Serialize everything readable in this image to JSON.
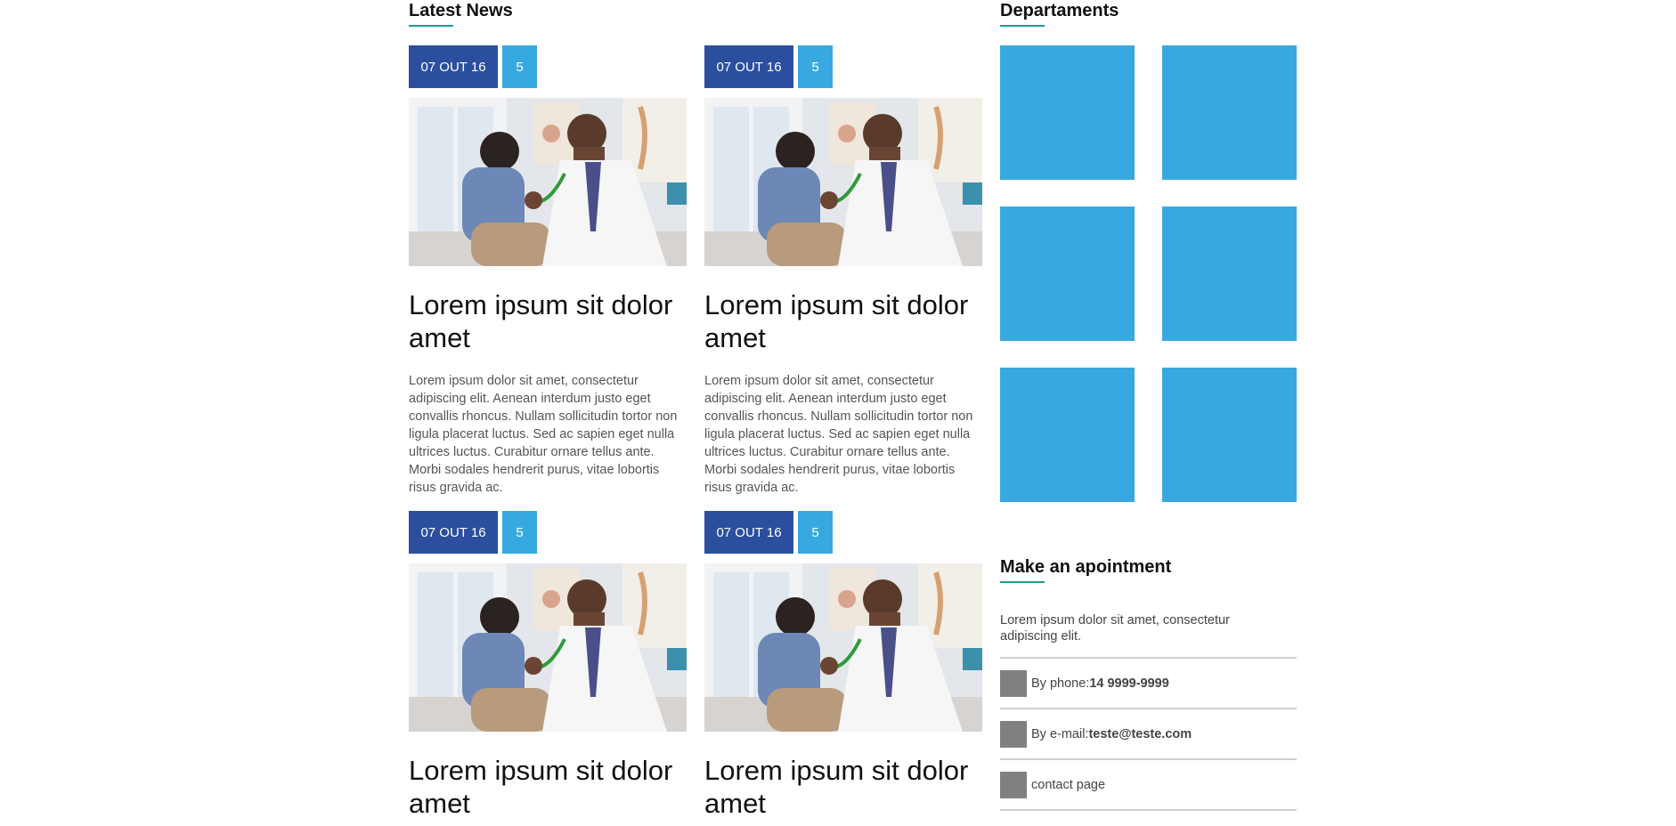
{
  "news": {
    "title": "Latest News",
    "cards": [
      {
        "date": "07 OUT 16",
        "count": "5",
        "title": "Lorem ipsum sit dolor amet",
        "text": "Lorem ipsum dolor sit amet, consectetur adipiscing elit. Aenean interdum justo eget convallis rhoncus. Nullam sollicitudin tortor non ligula placerat luctus. Sed ac sapien eget nulla ultrices luctus. Curabitur ornare tellus ante. Morbi sodales hendrerit purus, vitae lobortis risus gravida ac."
      },
      {
        "date": "07 OUT 16",
        "count": "5",
        "title": "Lorem ipsum sit dolor amet",
        "text": "Lorem ipsum dolor sit amet, consectetur adipiscing elit. Aenean interdum justo eget convallis rhoncus. Nullam sollicitudin tortor non ligula placerat luctus. Sed ac sapien eget nulla ultrices luctus. Curabitur ornare tellus ante. Morbi sodales hendrerit purus, vitae lobortis risus gravida ac."
      },
      {
        "date": "07 OUT 16",
        "count": "5",
        "title": "Lorem ipsum sit dolor amet",
        "text": ""
      },
      {
        "date": "07 OUT 16",
        "count": "5",
        "title": "Lorem ipsum sit dolor amet",
        "text": ""
      }
    ]
  },
  "departments": {
    "title": "Departaments",
    "tile_color": "#38a9e0",
    "tiles": [
      "",
      "",
      "",
      "",
      "",
      ""
    ]
  },
  "appointment": {
    "title": "Make an apointment",
    "text": "Lorem ipsum dolor sit amet, consectetur adipiscing elit.",
    "contacts": [
      {
        "icon": "phone-icon",
        "label": "By phone:",
        "value": "14 9999-9999"
      },
      {
        "icon": "email-icon",
        "label": "By e-mail:",
        "value": "teste@teste.com"
      },
      {
        "icon": "contact-icon",
        "label": "contact page",
        "value": ""
      }
    ]
  },
  "colors": {
    "date_badge": "#2b4f9e",
    "count_badge": "#38a9e0",
    "accent_underline": "#1a9e8f"
  }
}
